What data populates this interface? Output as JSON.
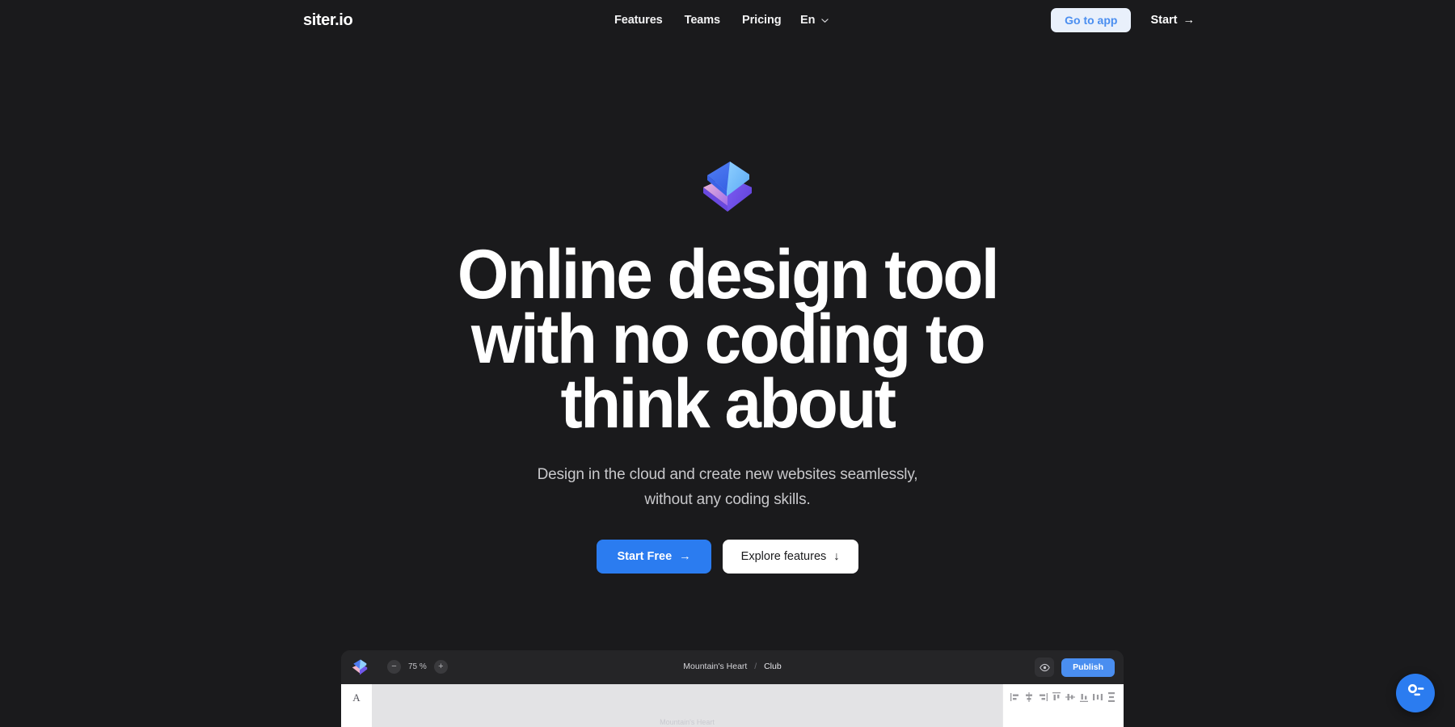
{
  "header": {
    "brand": "siter.io",
    "nav": [
      {
        "label": "Features"
      },
      {
        "label": "Teams"
      },
      {
        "label": "Pricing"
      }
    ],
    "language": {
      "label": "En",
      "icon": "chevron-down-icon"
    },
    "go_to_app_label": "Go to app",
    "start_label": "Start",
    "start_arrow": "→"
  },
  "hero": {
    "logo_icon": "siter-stacked-cube-logo",
    "headline_line1": "Online design tool",
    "headline_line2": "with no coding to",
    "headline_line3": "think about",
    "subtitle_line1": "Design in the cloud and create new websites seamlessly,",
    "subtitle_line2": "without any coding skills.",
    "primary_cta": {
      "label": "Start Free",
      "arrow": "→"
    },
    "secondary_cta": {
      "label": "Explore features",
      "arrow": "↓"
    }
  },
  "app_preview": {
    "logo_icon": "siter-stacked-cube-logo",
    "zoom": {
      "minus_label": "−",
      "value": "75 %",
      "plus_label": "+"
    },
    "breadcrumb": {
      "root": "Mountain's Heart",
      "separator": "/",
      "current": "Club"
    },
    "preview_icon": "eye-icon",
    "publish_label": "Publish",
    "left_tool_label": "A",
    "canvas_ghost_text": "Mountain's Heart",
    "align_icons": [
      "align-left-icon",
      "align-center-horizontal-icon",
      "align-right-icon",
      "align-top-icon",
      "align-middle-vertical-icon",
      "align-bottom-icon",
      "distribute-horizontal-icon",
      "distribute-vertical-icon"
    ]
  },
  "chat_widget": {
    "icon": "chat-support-icon"
  },
  "colors": {
    "page_background": "#1a1a1c",
    "accent_blue": "#2b7cf0",
    "publish_blue": "#4a8ef0",
    "go_to_app_bg": "#e9f0fb",
    "go_to_app_text": "#4a8ef0",
    "headline_white": "#ffffff",
    "subtitle_gray": "#c8c8cb"
  }
}
